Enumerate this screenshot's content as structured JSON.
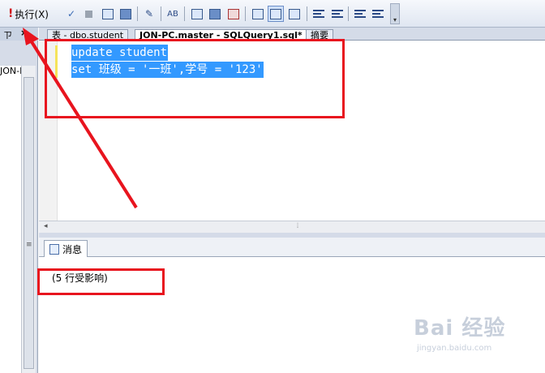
{
  "toolbar": {
    "execute_label": "执行(X)",
    "icons": [
      "exclamation-icon",
      "check-icon",
      "stop-icon",
      "display-plan-icon",
      "query-designer-icon",
      "edit-icon",
      "intellisense-icon",
      "results-to-text-icon",
      "results-to-grid-icon",
      "results-to-file-icon",
      "include-plan-icon",
      "client-stats-icon",
      "sqlcmd-icon",
      "comment-icon",
      "uncomment-icon",
      "outdent-icon",
      "indent-icon"
    ]
  },
  "left_panel": {
    "pin_glyph": "ㄗ",
    "close_glyph": "×",
    "tree_text": "JON-PC"
  },
  "tabs": [
    {
      "label": "表 - dbo.student"
    },
    {
      "label": "JON-PC.master - SQLQuery1.sql*"
    },
    {
      "label": "摘要"
    }
  ],
  "editor": {
    "lines": [
      "update student",
      "set 班级 = '一班',学号 = '123'"
    ]
  },
  "messages": {
    "tab_label": "消息",
    "text": "(5 行受影响)"
  },
  "watermark": {
    "brand": "Bai  经验",
    "url": "jingyan.baidu.com"
  },
  "colors": {
    "selection": "#3399ff",
    "annotation_red": "#e8141e"
  }
}
